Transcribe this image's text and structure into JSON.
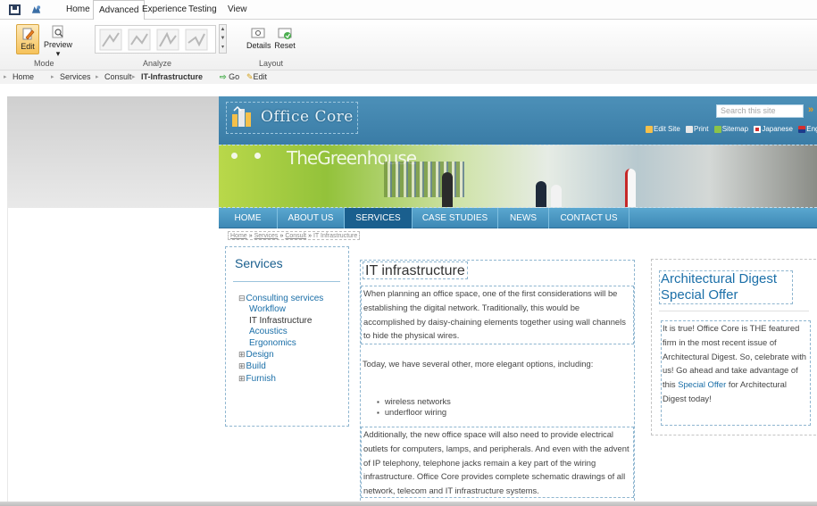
{
  "ribbon": {
    "tabs": [
      "Home",
      "Advanced",
      "Experience",
      "Testing",
      "View"
    ],
    "active_tab": "Advanced",
    "mode": {
      "label": "Mode",
      "edit": "Edit",
      "preview": "Preview"
    },
    "analyze": {
      "label": "Analyze"
    },
    "layout": {
      "label": "Layout",
      "details": "Details",
      "reset": "Reset"
    }
  },
  "path_bar": {
    "items": [
      "Home",
      "Services",
      "Consult",
      "IT-Infrastructure"
    ],
    "go": "Go",
    "edit": "Edit"
  },
  "site": {
    "logo": "Office Core",
    "search_placeholder": "Search this site",
    "tools": [
      "Edit Site",
      "Print",
      "Sitemap",
      "Japanese",
      "Engl"
    ],
    "banner_text": "TheGreenhouse",
    "nav": [
      "HOME",
      "ABOUT US",
      "SERVICES",
      "CASE STUDIES",
      "NEWS",
      "CONTACT US"
    ],
    "active_nav": "SERVICES",
    "breadcrumb": [
      "Home",
      "Services",
      "Consult",
      "IT Infrastructure"
    ],
    "sidebar": {
      "title": "Services",
      "items": [
        {
          "toggle": "⊟",
          "label": "Consulting services"
        },
        {
          "label": "Workflow"
        },
        {
          "label": "IT Infrastructure"
        },
        {
          "label": "Acoustics"
        },
        {
          "label": "Ergonomics"
        },
        {
          "toggle": "⊞",
          "label": "Design"
        },
        {
          "toggle": "⊞",
          "label": "Build"
        },
        {
          "toggle": "⊞",
          "label": "Furnish"
        }
      ]
    },
    "main": {
      "title": "IT infrastructure",
      "p1": "When planning an office space, one of the first considerations will be establishing the digital network. Traditionally, this would be accomplished by daisy-chaining elements together using wall channels to hide the physical wires.",
      "p2": "Today, we have several other, more elegant options, including:",
      "bullets": [
        "wireless networks",
        "underfloor wiring"
      ],
      "p3": "Additionally, the new office space will also need to provide electrical outlets for computers, lamps, and peripherals. And even with the advent of IP telephony, telephone jacks remain a key part of the wiring infrastructure. Office Core provides complete schematic drawings of all network, telecom and IT infrastructure systems."
    },
    "promo": {
      "title": "Architectural Digest Special Offer",
      "text_before": "It is true! Office Core is THE featured firm in the most recent issue of Architectural Digest. So, celebrate with us! Go ahead and take advantage of this ",
      "link": "Special Offer",
      "text_after": " for Architectural Digest today!"
    }
  },
  "colors": {
    "header_blue": "#3a7ca6",
    "nav_active": "#1a5f8e",
    "link_blue": "#1b6fa8",
    "edit_highlight": "#f6c25a"
  }
}
